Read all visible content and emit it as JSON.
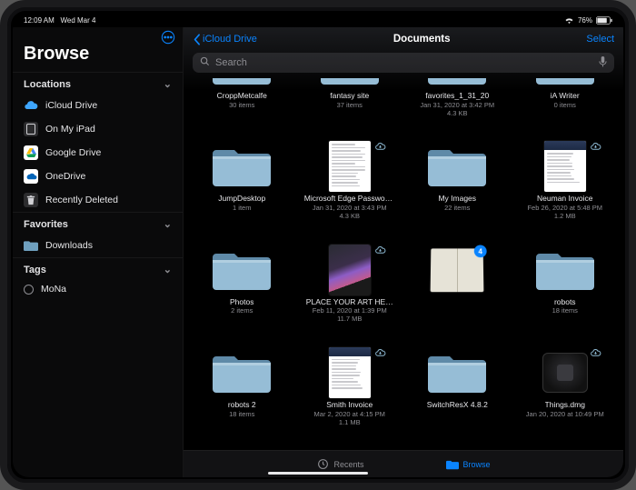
{
  "status": {
    "time": "12:09 AM",
    "date": "Wed Mar 4",
    "battery_pct": "76%"
  },
  "sidebar": {
    "title": "Browse",
    "sections": {
      "locations": {
        "header": "Locations",
        "items": [
          {
            "label": "iCloud Drive",
            "icon": "icloud-icon"
          },
          {
            "label": "On My iPad",
            "icon": "ipad-icon"
          },
          {
            "label": "Google Drive",
            "icon": "gdrive-icon"
          },
          {
            "label": "OneDrive",
            "icon": "onedrive-icon"
          },
          {
            "label": "Recently Deleted",
            "icon": "trash-icon"
          }
        ]
      },
      "favorites": {
        "header": "Favorites",
        "items": [
          {
            "label": "Downloads",
            "icon": "folder-icon"
          }
        ]
      },
      "tags": {
        "header": "Tags",
        "items": [
          {
            "label": "MoNa",
            "icon": "tag-dot"
          }
        ]
      }
    }
  },
  "nav": {
    "back": "iCloud Drive",
    "title": "Documents",
    "select": "Select"
  },
  "search": {
    "placeholder": "Search"
  },
  "grid": [
    {
      "name": "CroppMetcalfe",
      "meta1": "30 items",
      "meta2": "",
      "kind": "folder",
      "cloud": false
    },
    {
      "name": "fantasy site",
      "meta1": "37 items",
      "meta2": "",
      "kind": "folder",
      "cloud": false
    },
    {
      "name": "favorites_1_31_20",
      "meta1": "Jan 31, 2020 at 3:42 PM",
      "meta2": "4.3 KB",
      "kind": "folder",
      "cloud": false
    },
    {
      "name": "iA Writer",
      "meta1": "0 items",
      "meta2": "",
      "kind": "folder",
      "cloud": false
    },
    {
      "name": "JumpDesktop",
      "meta1": "1 item",
      "meta2": "",
      "kind": "folder",
      "cloud": false
    },
    {
      "name": "Microsoft Edge Passwords",
      "meta1": "Jan 31, 2020 at 3:43 PM",
      "meta2": "4.3 KB",
      "kind": "doc",
      "cloud": true
    },
    {
      "name": "My Images",
      "meta1": "22 items",
      "meta2": "",
      "kind": "folder",
      "cloud": false
    },
    {
      "name": "Neuman Invoice",
      "meta1": "Feb 26, 2020 at 5:48 PM",
      "meta2": "1.2 MB",
      "kind": "doc-inv",
      "cloud": true
    },
    {
      "name": "Photos",
      "meta1": "2 items",
      "meta2": "",
      "kind": "folder",
      "cloud": false
    },
    {
      "name": "PLACE YOUR ART HE…",
      "meta1": "Feb 11, 2020 at 1:39 PM",
      "meta2": "11.7 MB",
      "kind": "image",
      "cloud": true
    },
    {
      "name": "",
      "meta1": "",
      "meta2": "",
      "kind": "book",
      "badge": "4",
      "cloud": false
    },
    {
      "name": "robots",
      "meta1": "18 items",
      "meta2": "",
      "kind": "folder",
      "cloud": false
    },
    {
      "name": "robots 2",
      "meta1": "18 items",
      "meta2": "",
      "kind": "folder",
      "cloud": false
    },
    {
      "name": "Smith Invoice",
      "meta1": "Mar 2, 2020 at 4:15 PM",
      "meta2": "1.1 MB",
      "kind": "doc-inv",
      "cloud": true
    },
    {
      "name": "SwitchResX 4.8.2",
      "meta1": "",
      "meta2": "",
      "kind": "folder",
      "cloud": false
    },
    {
      "name": "Things.dmg",
      "meta1": "Jan 20, 2020 at 10:49 PM",
      "meta2": "",
      "kind": "dmg",
      "cloud": true
    }
  ],
  "tabs": {
    "recents": "Recents",
    "browse": "Browse"
  }
}
